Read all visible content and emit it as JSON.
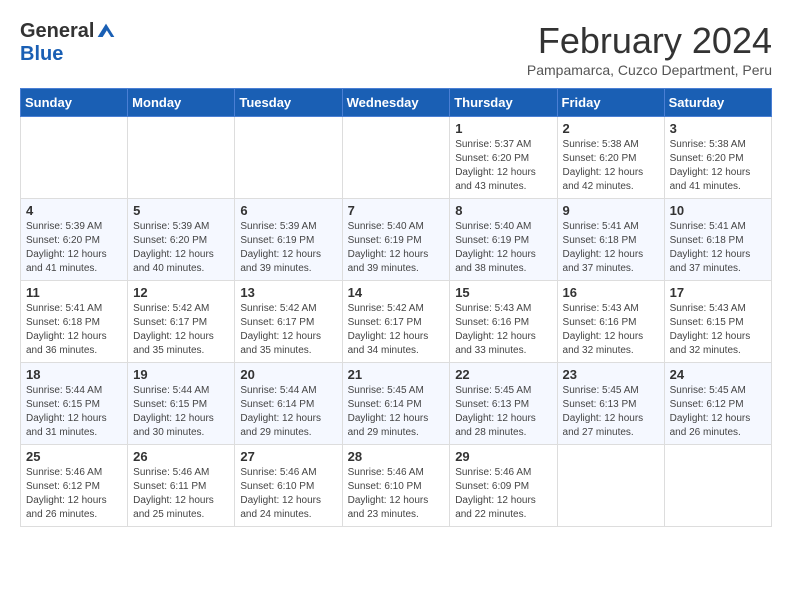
{
  "header": {
    "logo": {
      "general": "General",
      "blue": "Blue"
    },
    "title": "February 2024",
    "location": "Pampamarca, Cuzco Department, Peru"
  },
  "calendar": {
    "weekdays": [
      "Sunday",
      "Monday",
      "Tuesday",
      "Wednesday",
      "Thursday",
      "Friday",
      "Saturday"
    ],
    "weeks": [
      [
        {
          "day": "",
          "info": ""
        },
        {
          "day": "",
          "info": ""
        },
        {
          "day": "",
          "info": ""
        },
        {
          "day": "",
          "info": ""
        },
        {
          "day": "1",
          "info": "Sunrise: 5:37 AM\nSunset: 6:20 PM\nDaylight: 12 hours\nand 43 minutes."
        },
        {
          "day": "2",
          "info": "Sunrise: 5:38 AM\nSunset: 6:20 PM\nDaylight: 12 hours\nand 42 minutes."
        },
        {
          "day": "3",
          "info": "Sunrise: 5:38 AM\nSunset: 6:20 PM\nDaylight: 12 hours\nand 41 minutes."
        }
      ],
      [
        {
          "day": "4",
          "info": "Sunrise: 5:39 AM\nSunset: 6:20 PM\nDaylight: 12 hours\nand 41 minutes."
        },
        {
          "day": "5",
          "info": "Sunrise: 5:39 AM\nSunset: 6:20 PM\nDaylight: 12 hours\nand 40 minutes."
        },
        {
          "day": "6",
          "info": "Sunrise: 5:39 AM\nSunset: 6:19 PM\nDaylight: 12 hours\nand 39 minutes."
        },
        {
          "day": "7",
          "info": "Sunrise: 5:40 AM\nSunset: 6:19 PM\nDaylight: 12 hours\nand 39 minutes."
        },
        {
          "day": "8",
          "info": "Sunrise: 5:40 AM\nSunset: 6:19 PM\nDaylight: 12 hours\nand 38 minutes."
        },
        {
          "day": "9",
          "info": "Sunrise: 5:41 AM\nSunset: 6:18 PM\nDaylight: 12 hours\nand 37 minutes."
        },
        {
          "day": "10",
          "info": "Sunrise: 5:41 AM\nSunset: 6:18 PM\nDaylight: 12 hours\nand 37 minutes."
        }
      ],
      [
        {
          "day": "11",
          "info": "Sunrise: 5:41 AM\nSunset: 6:18 PM\nDaylight: 12 hours\nand 36 minutes."
        },
        {
          "day": "12",
          "info": "Sunrise: 5:42 AM\nSunset: 6:17 PM\nDaylight: 12 hours\nand 35 minutes."
        },
        {
          "day": "13",
          "info": "Sunrise: 5:42 AM\nSunset: 6:17 PM\nDaylight: 12 hours\nand 35 minutes."
        },
        {
          "day": "14",
          "info": "Sunrise: 5:42 AM\nSunset: 6:17 PM\nDaylight: 12 hours\nand 34 minutes."
        },
        {
          "day": "15",
          "info": "Sunrise: 5:43 AM\nSunset: 6:16 PM\nDaylight: 12 hours\nand 33 minutes."
        },
        {
          "day": "16",
          "info": "Sunrise: 5:43 AM\nSunset: 6:16 PM\nDaylight: 12 hours\nand 32 minutes."
        },
        {
          "day": "17",
          "info": "Sunrise: 5:43 AM\nSunset: 6:15 PM\nDaylight: 12 hours\nand 32 minutes."
        }
      ],
      [
        {
          "day": "18",
          "info": "Sunrise: 5:44 AM\nSunset: 6:15 PM\nDaylight: 12 hours\nand 31 minutes."
        },
        {
          "day": "19",
          "info": "Sunrise: 5:44 AM\nSunset: 6:15 PM\nDaylight: 12 hours\nand 30 minutes."
        },
        {
          "day": "20",
          "info": "Sunrise: 5:44 AM\nSunset: 6:14 PM\nDaylight: 12 hours\nand 29 minutes."
        },
        {
          "day": "21",
          "info": "Sunrise: 5:45 AM\nSunset: 6:14 PM\nDaylight: 12 hours\nand 29 minutes."
        },
        {
          "day": "22",
          "info": "Sunrise: 5:45 AM\nSunset: 6:13 PM\nDaylight: 12 hours\nand 28 minutes."
        },
        {
          "day": "23",
          "info": "Sunrise: 5:45 AM\nSunset: 6:13 PM\nDaylight: 12 hours\nand 27 minutes."
        },
        {
          "day": "24",
          "info": "Sunrise: 5:45 AM\nSunset: 6:12 PM\nDaylight: 12 hours\nand 26 minutes."
        }
      ],
      [
        {
          "day": "25",
          "info": "Sunrise: 5:46 AM\nSunset: 6:12 PM\nDaylight: 12 hours\nand 26 minutes."
        },
        {
          "day": "26",
          "info": "Sunrise: 5:46 AM\nSunset: 6:11 PM\nDaylight: 12 hours\nand 25 minutes."
        },
        {
          "day": "27",
          "info": "Sunrise: 5:46 AM\nSunset: 6:10 PM\nDaylight: 12 hours\nand 24 minutes."
        },
        {
          "day": "28",
          "info": "Sunrise: 5:46 AM\nSunset: 6:10 PM\nDaylight: 12 hours\nand 23 minutes."
        },
        {
          "day": "29",
          "info": "Sunrise: 5:46 AM\nSunset: 6:09 PM\nDaylight: 12 hours\nand 22 minutes."
        },
        {
          "day": "",
          "info": ""
        },
        {
          "day": "",
          "info": ""
        }
      ]
    ]
  }
}
